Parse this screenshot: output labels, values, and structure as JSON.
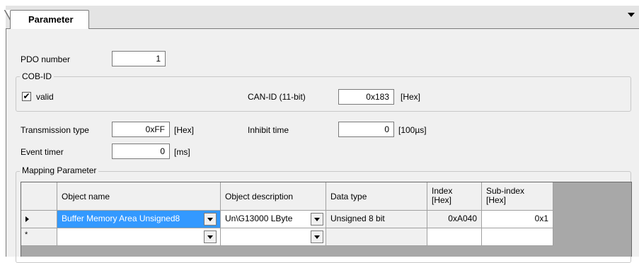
{
  "tab": {
    "label": "Parameter"
  },
  "pdo": {
    "label": "PDO number",
    "value": "1"
  },
  "cobid": {
    "group_title": "COB-ID",
    "valid_label": "valid",
    "valid_checked": true,
    "check_glyph": "✔",
    "canid_label": "CAN-ID (11-bit)",
    "canid_value": "0x183",
    "canid_unit": "[Hex]"
  },
  "transmission": {
    "label": "Transmission type",
    "value": "0xFF",
    "unit": "[Hex]"
  },
  "inhibit": {
    "label": "Inhibit time",
    "value": "0",
    "unit": "[100µs]"
  },
  "event_timer": {
    "label": "Event timer",
    "value": "0",
    "unit": "[ms]"
  },
  "mapping": {
    "group_title": "Mapping Parameter",
    "headers": {
      "object_name": "Object name",
      "object_description": "Object description",
      "data_type": "Data type",
      "index_line1": "Index",
      "index_line2": "[Hex]",
      "subindex_line1": "Sub-index",
      "subindex_line2": "[Hex]"
    },
    "rows": [
      {
        "object_name": "Buffer Memory Area Unsigned8",
        "object_description": "Un\\G13000 LByte",
        "data_type": "Unsigned 8 bit",
        "index": "0xA040",
        "subindex": "0x1"
      }
    ],
    "new_row_marker": "*"
  },
  "colors": {
    "selection": "#3399ff",
    "panel_bg": "#f0f0f0",
    "grid_empty_bg": "#a8a8a8"
  },
  "icons": [
    "dropdown-arrow-icon",
    "row-pointer-icon",
    "checkmark-icon",
    "tab-menu-arrow-icon"
  ]
}
